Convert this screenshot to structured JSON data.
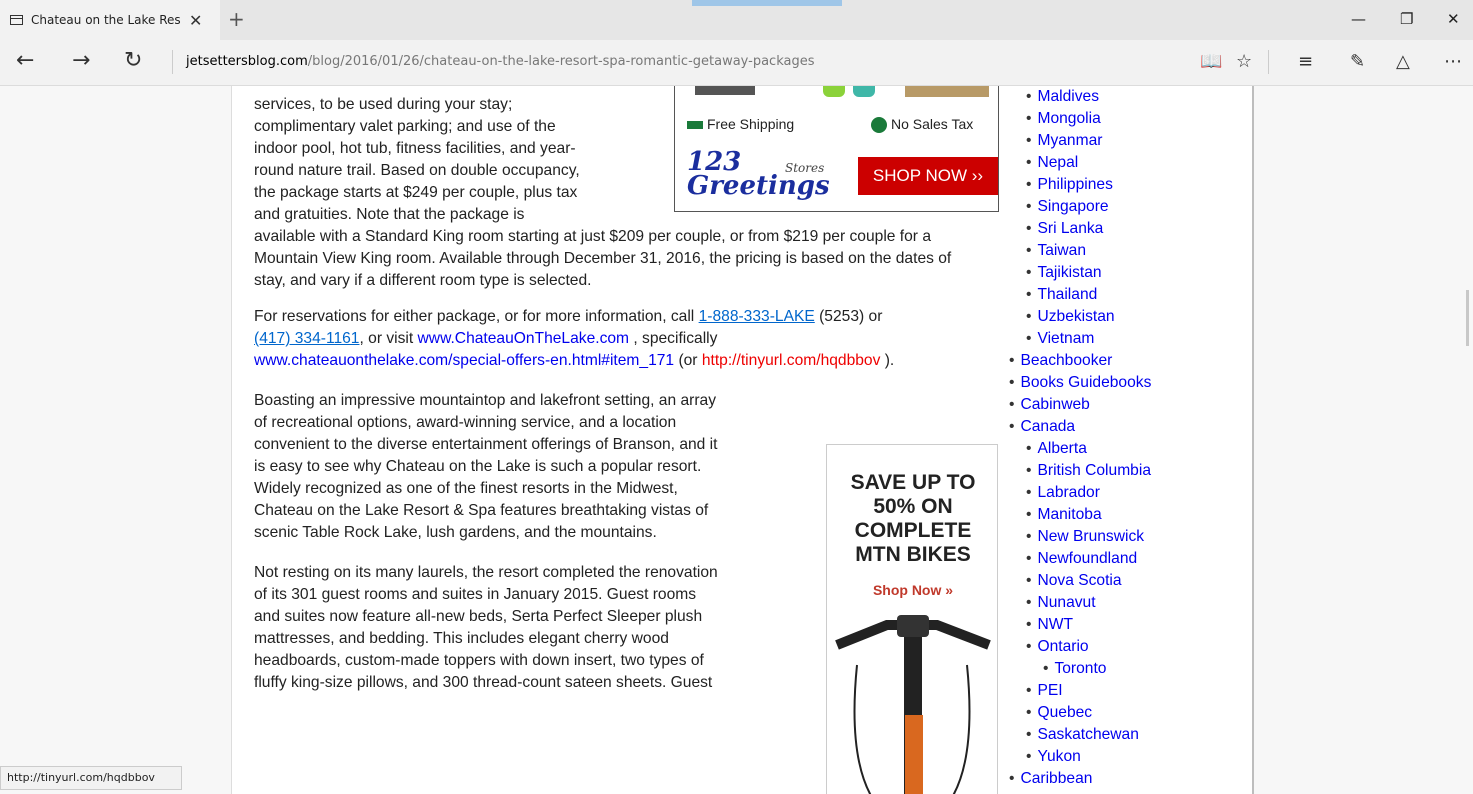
{
  "browser": {
    "tab_title": "Chateau on the Lake Res",
    "new_tab_label": "+",
    "tab_close": "✕",
    "address_domain": "jetsettersblog.com",
    "address_path": "/blog/2016/01/26/chateau-on-the-lake-resort-spa-romantic-getaway-packages",
    "status_url": "http://tinyurl.com/hqdbbov"
  },
  "article": {
    "p1_lines_left": [
      "services, to be used during your stay;",
      "complimentary valet parking; and use of the",
      "indoor pool, hot tub, fitness facilities, and year-",
      "round nature trail. Based on double occupancy,",
      "the package starts at $249 per couple, plus tax",
      "and gratuities. Note that the package is"
    ],
    "p1_rest": "available with a Standard King room starting at just $209 per couple, or from $219 per couple for a Mountain View King room. Available through December 31, 2016, the pricing is based on the dates of stay, and vary if a different room type is selected.",
    "p2_a": "For reservations for either package, or for more information, call ",
    "p2_phone1": "1-888-333-LAKE",
    "p2_b": " (5253) or ",
    "p2_phone2": "(417) 334-1161",
    "p2_c": ", or visit ",
    "p2_site": "www.ChateauOnTheLake.com",
    "p2_d": " , specifically ",
    "p2_offers": "www.chateauonthelake.com/special-offers-en.html#item_171",
    "p2_e": " (or ",
    "p2_tiny": "http://tinyurl.com/hqdbbov",
    "p2_f": " ).",
    "p3_lines": [
      "Boasting an impressive mountaintop and lakefront setting, an array",
      "of recreational options, award-winning service, and a location",
      "convenient to the diverse entertainment offerings of Branson, and it",
      "is easy to see why Chateau on the Lake is such a popular resort.",
      "Widely recognized as one of the finest resorts in the Midwest,",
      "Chateau on the Lake Resort & Spa features breathtaking vistas of",
      "scenic Table Rock Lake, lush gardens, and the mountains."
    ],
    "p4_lines": [
      "Not resting on its many laurels, the resort completed the renovation",
      "of its 301 guest rooms and suites in January 2015. Guest rooms",
      "and suites now feature all-new beds, Serta Perfect Sleeper plush",
      "mattresses, and bedding. This includes elegant cherry wood",
      "headboards, custom-made toppers with down insert, two types of",
      "fluffy king-size pillows, and 300 thread-count sateen sheets. Guest"
    ]
  },
  "ad_greetings": {
    "free_shipping": "Free Shipping",
    "no_sales_tax": "No Sales Tax",
    "brand_123": "123",
    "brand_stores": "Stores",
    "brand_greetings": "Greetings",
    "shop_now": "SHOP NOW ››"
  },
  "ad_bikes": {
    "headline": [
      "SAVE UP TO",
      "50% ON",
      "COMPLETE",
      "MTN BIKES"
    ],
    "cta": "Shop Now »"
  },
  "sidebar": {
    "items": [
      {
        "level": 2,
        "label": "Maldives"
      },
      {
        "level": 2,
        "label": "Mongolia"
      },
      {
        "level": 2,
        "label": "Myanmar"
      },
      {
        "level": 2,
        "label": "Nepal"
      },
      {
        "level": 2,
        "label": "Philippines"
      },
      {
        "level": 2,
        "label": "Singapore"
      },
      {
        "level": 2,
        "label": "Sri Lanka"
      },
      {
        "level": 2,
        "label": "Taiwan"
      },
      {
        "level": 2,
        "label": "Tajikistan"
      },
      {
        "level": 2,
        "label": "Thailand"
      },
      {
        "level": 2,
        "label": "Uzbekistan"
      },
      {
        "level": 2,
        "label": "Vietnam"
      },
      {
        "level": 1,
        "label": "Beachbooker"
      },
      {
        "level": 1,
        "label": "Books Guidebooks"
      },
      {
        "level": 1,
        "label": "Cabinweb"
      },
      {
        "level": 1,
        "label": "Canada"
      },
      {
        "level": 2,
        "label": "Alberta"
      },
      {
        "level": 2,
        "label": "British Columbia"
      },
      {
        "level": 2,
        "label": "Labrador"
      },
      {
        "level": 2,
        "label": "Manitoba"
      },
      {
        "level": 2,
        "label": "New Brunswick"
      },
      {
        "level": 2,
        "label": "Newfoundland"
      },
      {
        "level": 2,
        "label": "Nova Scotia"
      },
      {
        "level": 2,
        "label": "Nunavut"
      },
      {
        "level": 2,
        "label": "NWT"
      },
      {
        "level": 2,
        "label": "Ontario"
      },
      {
        "level": 3,
        "label": "Toronto"
      },
      {
        "level": 2,
        "label": "PEI"
      },
      {
        "level": 2,
        "label": "Quebec"
      },
      {
        "level": 2,
        "label": "Saskatchewan"
      },
      {
        "level": 2,
        "label": "Yukon"
      },
      {
        "level": 1,
        "label": "Caribbean"
      }
    ]
  }
}
